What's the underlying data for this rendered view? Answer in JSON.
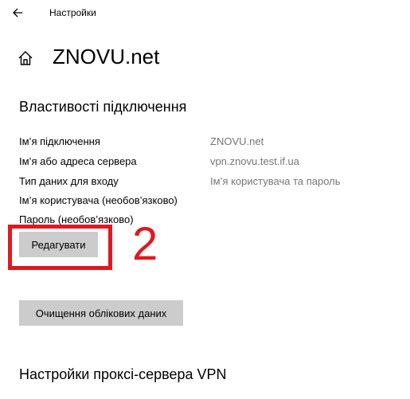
{
  "window": {
    "title": "Настройки"
  },
  "page": {
    "title": "ZNOVU.net"
  },
  "connection_properties": {
    "heading": "Властивості підключення",
    "rows": [
      {
        "label": "Ім’я підключення",
        "value": "ZNOVU.net"
      },
      {
        "label": "Ім’я або адреса сервера",
        "value": "vpn.znovu.test.if.ua"
      },
      {
        "label": "Тип даних для входу",
        "value": "Ім’я користувача та пароль"
      },
      {
        "label": "Ім’я користувача (необов’язково)",
        "value": ""
      },
      {
        "label": "Пароль (необов’язково)",
        "value": ""
      }
    ]
  },
  "buttons": {
    "edit_label": "Редагувати",
    "clear_label": "Очищення облікових даних"
  },
  "annotation": {
    "number": "2",
    "color": "#e0191f"
  },
  "proxy": {
    "heading": "Настройки проксі-сервера VPN"
  },
  "icons": {
    "back": "back-arrow-icon",
    "home": "home-icon"
  }
}
